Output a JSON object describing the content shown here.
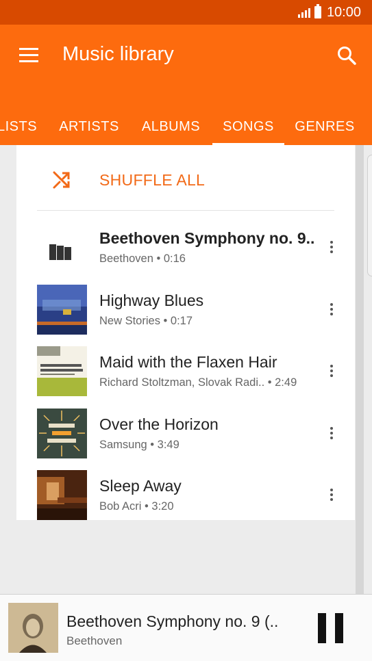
{
  "status_bar": {
    "time": "10:00"
  },
  "app_bar": {
    "title": "Music library"
  },
  "tabs": [
    {
      "label": "LISTS"
    },
    {
      "label": "ARTISTS"
    },
    {
      "label": "ALBUMS"
    },
    {
      "label": "SONGS",
      "active": true
    },
    {
      "label": "GENRES"
    }
  ],
  "shuffle": {
    "label": "SHUFFLE ALL"
  },
  "songs": [
    {
      "title": "Beethoven Symphony no. 9..",
      "subtitle": "Beethoven • 0:16",
      "playing": true
    },
    {
      "title": "Highway Blues",
      "subtitle": "New Stories • 0:17"
    },
    {
      "title": "Maid with the Flaxen Hair",
      "subtitle": "Richard Stoltzman, Slovak Radi..  • 2:49"
    },
    {
      "title": "Over the Horizon",
      "subtitle": "Samsung • 3:49"
    },
    {
      "title": "Sleep Away",
      "subtitle": "Bob Acri • 3:20"
    }
  ],
  "now_playing": {
    "title": "Beethoven Symphony no. 9 (..",
    "artist": "Beethoven"
  },
  "colors": {
    "status_bar": "#d84a00",
    "app_bar": "#fd6b0e",
    "accent": "#f26a18"
  },
  "icons": [
    "menu-icon",
    "search-icon",
    "shuffle-icon",
    "equalizer-icon",
    "more-vert-icon",
    "pause-icon"
  ]
}
